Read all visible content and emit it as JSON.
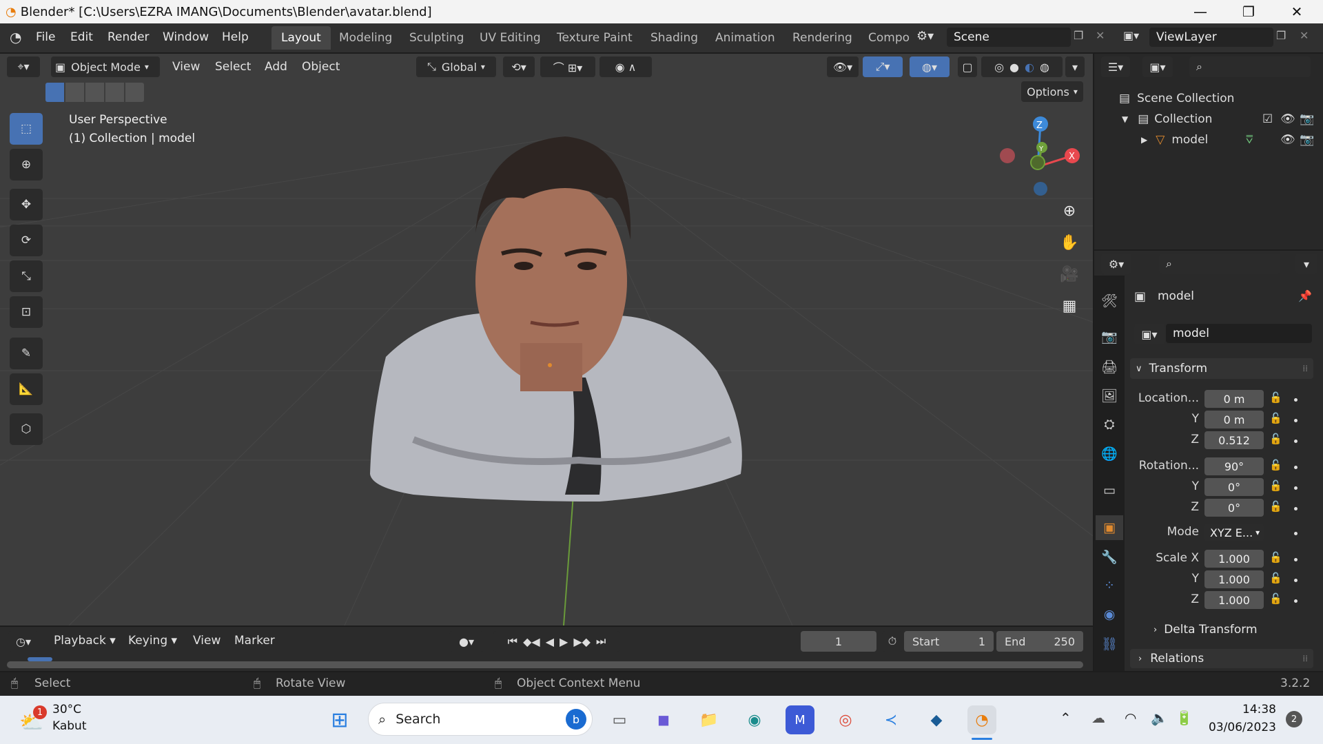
{
  "window": {
    "title": "Blender* [C:\\Users\\EZRA IMANG\\Documents\\Blender\\avatar.blend]",
    "minimize": "—",
    "maximize": "❐",
    "close": "✕"
  },
  "menu": [
    "File",
    "Edit",
    "Render",
    "Window",
    "Help"
  ],
  "workspaces": [
    "Layout",
    "Modeling",
    "Sculpting",
    "UV Editing",
    "Texture Paint",
    "Shading",
    "Animation",
    "Rendering",
    "Compo"
  ],
  "scene_field": "Scene",
  "viewlayer_field": "ViewLayer",
  "viewport_header": {
    "mode": "Object Mode",
    "menus": [
      "View",
      "Select",
      "Add",
      "Object"
    ],
    "orientation": "Global",
    "options": "Options"
  },
  "viewport_overlay": {
    "perspective": "User Perspective",
    "collection": "(1) Collection | model"
  },
  "gizmo": {
    "z": "Z",
    "y": "Y",
    "x": "X"
  },
  "outliner": {
    "scene_collection": "Scene Collection",
    "collection": "Collection",
    "object": "model"
  },
  "properties": {
    "object_name": "model",
    "datablock": "model",
    "panel_transform": "Transform",
    "location_label": "Location...",
    "location": [
      "0 m",
      "0 m",
      "0.512"
    ],
    "rotation_label": "Rotation...",
    "rotation": [
      "90°",
      "0°",
      "0°"
    ],
    "mode_label": "Mode",
    "mode_value": "XYZ E...",
    "scale_label": "Scale X",
    "scale": [
      "1.000",
      "1.000",
      "1.000"
    ],
    "axis_y": "Y",
    "axis_z": "Z",
    "delta": "Delta Transform",
    "relations": "Relations"
  },
  "timeline": {
    "menus": [
      "Playback",
      "Keying",
      "View",
      "Marker"
    ],
    "current_frame": "1",
    "start_label": "Start",
    "start": "1",
    "end_label": "End",
    "end": "250"
  },
  "statusbar": {
    "select": "Select",
    "rotate": "Rotate View",
    "context": "Object Context Menu",
    "version": "3.2.2"
  },
  "taskbar": {
    "weather_temp": "30°C",
    "weather_desc": "Kabut",
    "weather_badge": "1",
    "search": "Search",
    "time": "14:38",
    "date": "03/06/2023",
    "notif": "2"
  },
  "colors": {
    "accent": "#4772b3",
    "x_axis": "#e8484e",
    "y_axis": "#6fa13a",
    "z_axis": "#3d8ad9",
    "orange": "#e08a2e"
  }
}
